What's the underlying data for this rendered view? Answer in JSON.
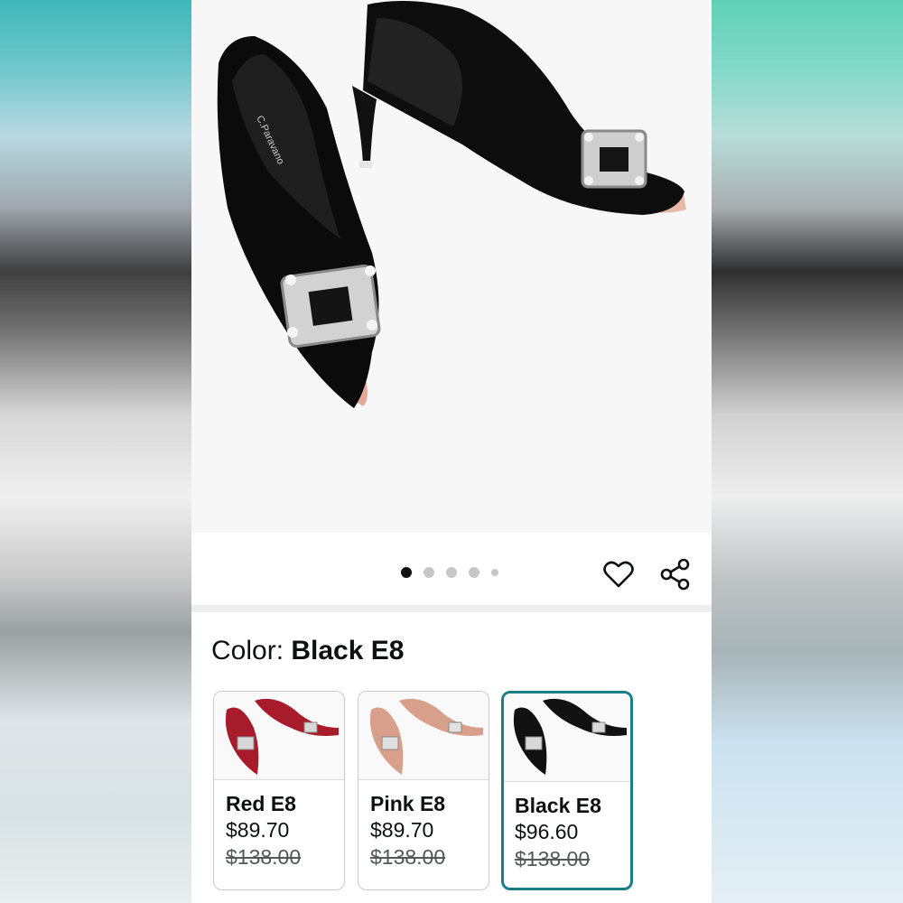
{
  "product": {
    "brand_on_insole": "C.Paravano"
  },
  "gallery": {
    "image_count": 5,
    "active_index": 0
  },
  "actions": {
    "wishlist_icon": "heart-icon",
    "share_icon": "share-icon"
  },
  "color": {
    "label_prefix": "Color:",
    "selected_value": "Black E8"
  },
  "swatches": [
    {
      "name": "Red E8",
      "price": "$89.70",
      "list_price": "$138.00",
      "color": "#a81b2a",
      "selected": false
    },
    {
      "name": "Pink E8",
      "price": "$89.70",
      "list_price": "$138.00",
      "color": "#d8a08a",
      "selected": false
    },
    {
      "name": "Black E8",
      "price": "$96.60",
      "list_price": "$138.00",
      "color": "#111111",
      "selected": true
    }
  ],
  "colors": {
    "selected_border": "#1a7e86",
    "text": "#0f1111",
    "muted": "#565959"
  }
}
